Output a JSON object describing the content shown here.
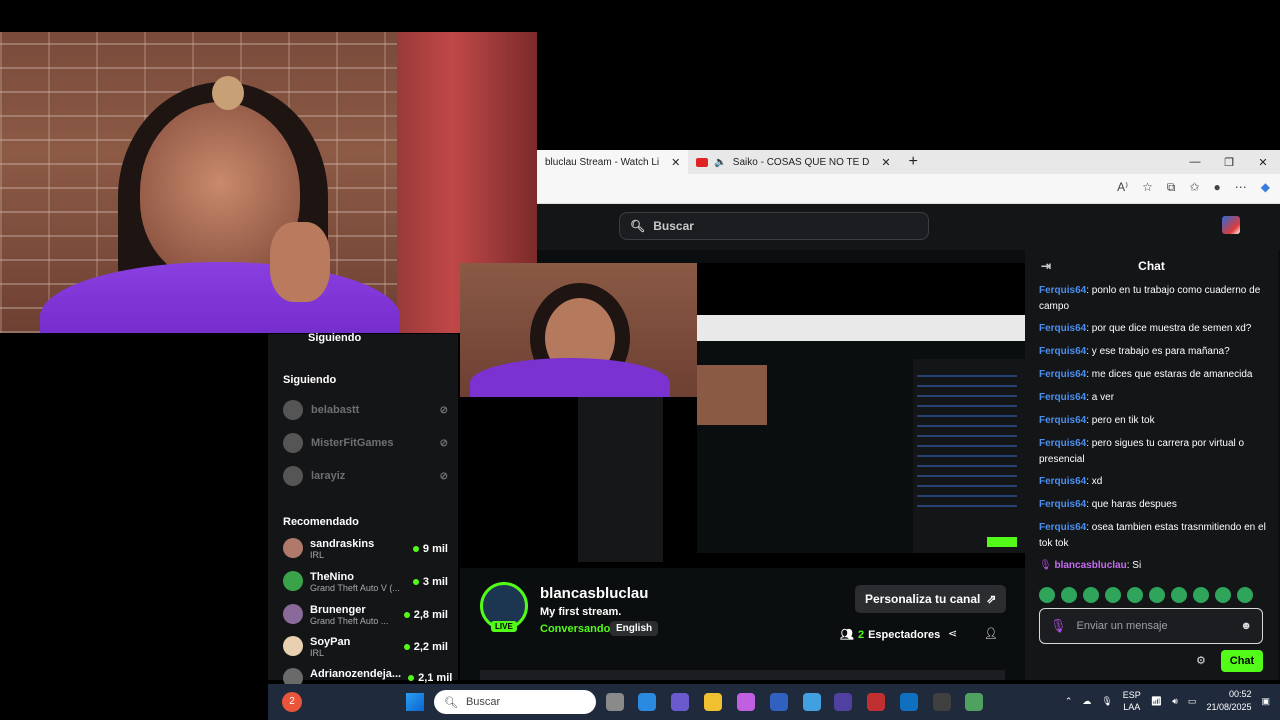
{
  "browser": {
    "tabs": [
      {
        "label": "bluclau Stream - Watch Li",
        "active": true
      },
      {
        "label": "Saiko - COSAS QUE NO TE D",
        "active": false
      }
    ],
    "new_tab": "+",
    "window_controls": [
      "—",
      "❐",
      "✕"
    ]
  },
  "kick": {
    "search_placeholder": "Buscar",
    "sidebar": {
      "following_cut": "Siguiendo",
      "following_header": "Siguiendo",
      "following": [
        {
          "name": "belabastt"
        },
        {
          "name": "MisterFitGames"
        },
        {
          "name": "larayiz"
        }
      ],
      "recommended_header": "Recomendado",
      "recommended": [
        {
          "name": "sandraskins",
          "category": "IRL",
          "viewers": "9 mil",
          "color": "#b07a6a"
        },
        {
          "name": "TheNino",
          "category": "Grand Theft Auto V (...",
          "viewers": "3 mil",
          "color": "#3aa34a"
        },
        {
          "name": "Brunenger",
          "category": "Grand Theft Auto ...",
          "viewers": "2,8 mil",
          "color": "#8a6a9a"
        },
        {
          "name": "SoyPan",
          "category": "IRL",
          "viewers": "2,2 mil",
          "color": "#e8d0b0"
        },
        {
          "name": "Adrianozendeja...",
          "category": "",
          "viewers": "2,1 mil",
          "color": "#6a6a6a"
        }
      ]
    },
    "stream": {
      "channel": "blancasbluclau",
      "title": "My first stream.",
      "category": "Conversando",
      "language": "English",
      "live_badge": "LIVE",
      "personalize_button": "Personaliza tu canal",
      "viewers_count": "2",
      "viewers_label": "Espectadores"
    },
    "chat": {
      "header": "Chat",
      "messages": [
        {
          "user": "Ferquis64",
          "text": ": ponlo en tu trabajo como cuaderno de campo"
        },
        {
          "user": "Ferquis64",
          "text": ": por que dice muestra de semen xd?"
        },
        {
          "user": "Ferquis64",
          "text": ": y ese trabajo es para mañana?"
        },
        {
          "user": "Ferquis64",
          "text": ": me dices que estaras de amanecida"
        },
        {
          "user": "Ferquis64",
          "text": ": a ver"
        },
        {
          "user": "Ferquis64",
          "text": ": pero en tik tok"
        },
        {
          "user": "Ferquis64",
          "text": ": pero sigues tu carrera por virtual o presencial"
        },
        {
          "user": "Ferquis64",
          "text": ": xd"
        },
        {
          "user": "Ferquis64",
          "text": ": que haras despues"
        },
        {
          "user": "Ferquis64",
          "text": ": osea tambien estas trasnmitiendo en el tok tok"
        },
        {
          "user": "blancasbluclau",
          "text": ": Si"
        }
      ],
      "input_placeholder": "Enviar un mensaje",
      "send_button": "Chat"
    }
  },
  "taskbar": {
    "search_placeholder": "Buscar",
    "notification_count": "2",
    "language": "ESP",
    "language_sub": "LAA",
    "time": "00:52",
    "date": "21/08/2025"
  }
}
